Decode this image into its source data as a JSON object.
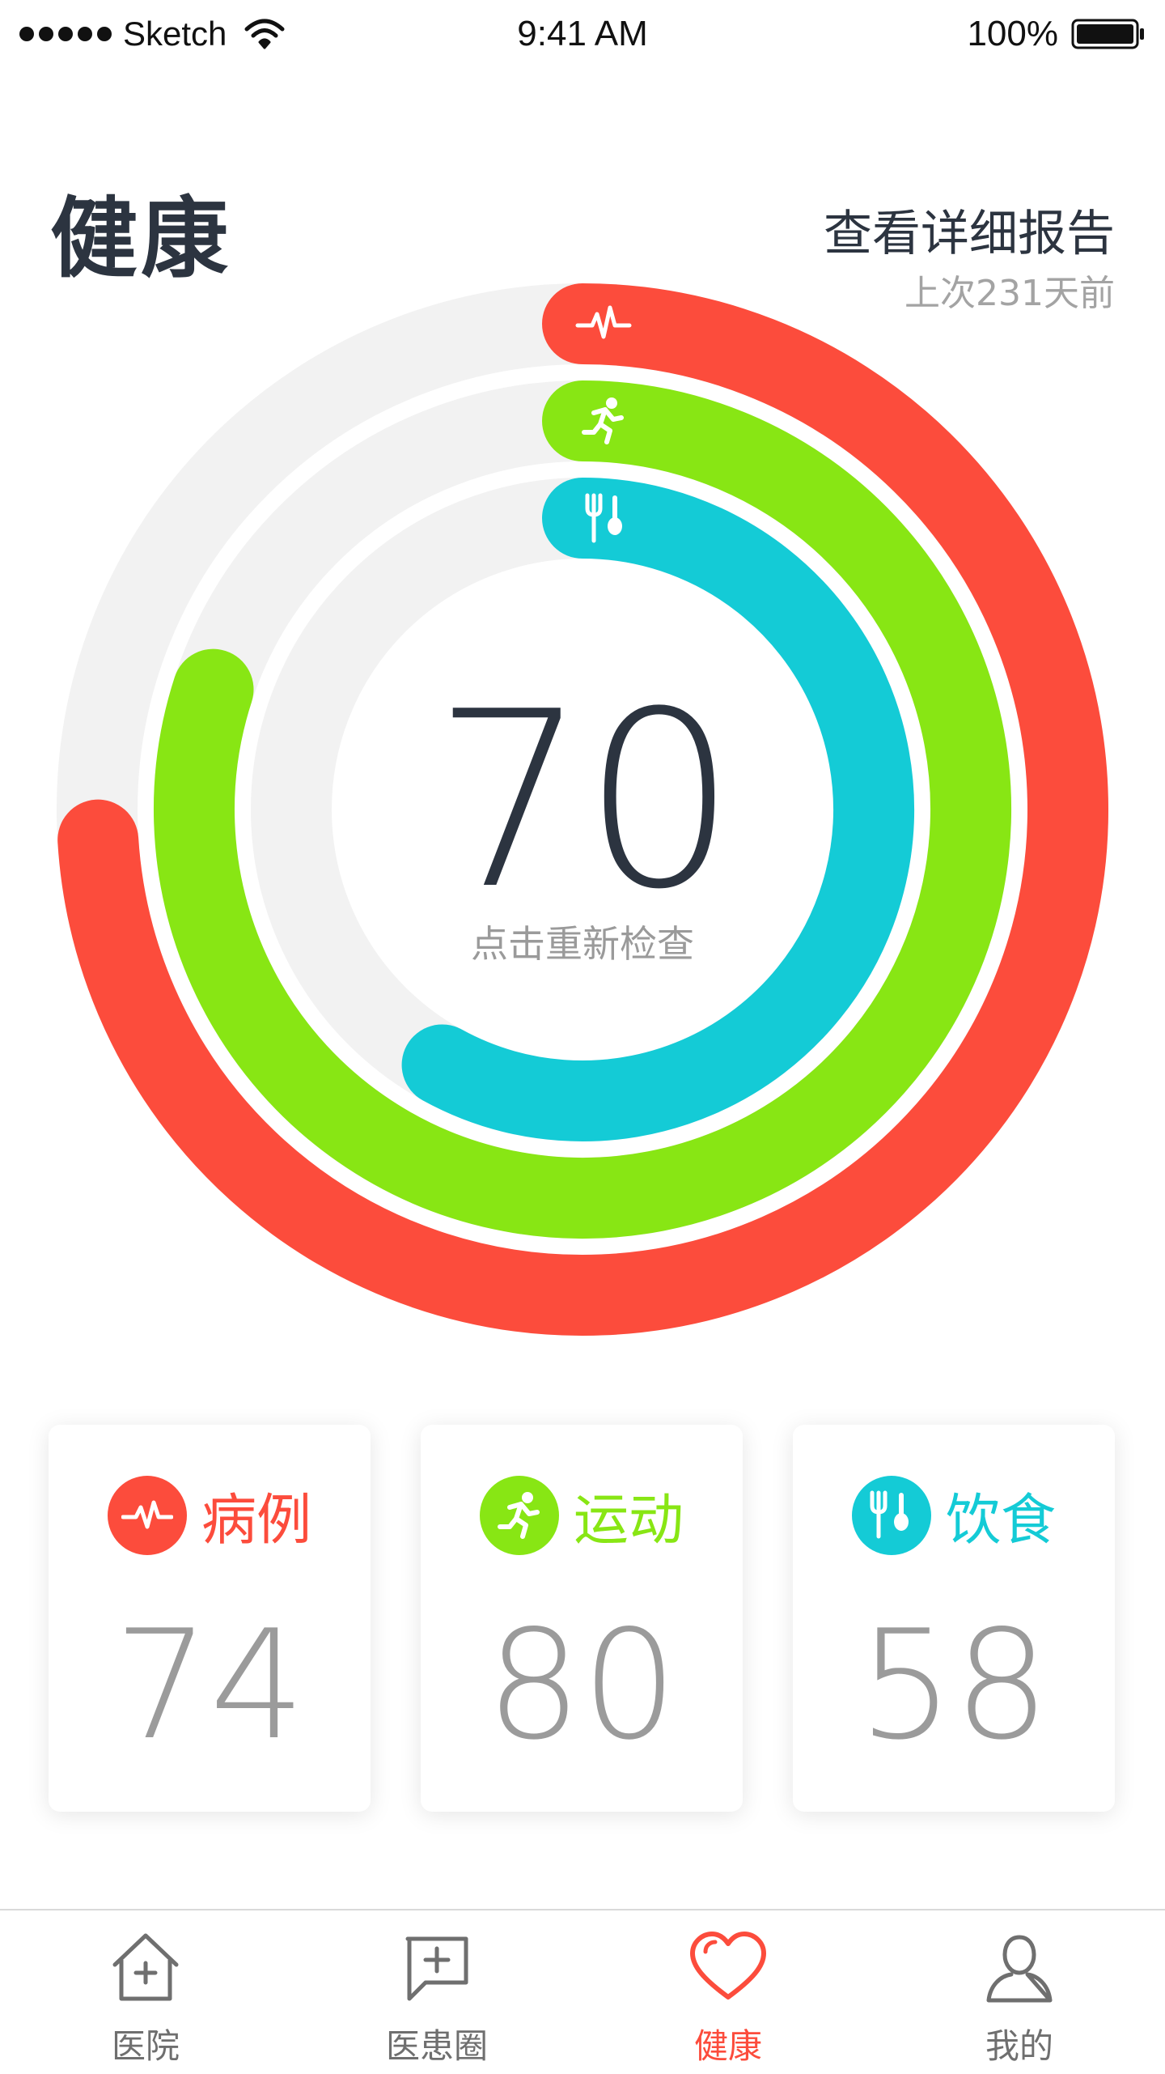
{
  "status_bar": {
    "carrier": "Sketch",
    "time": "9:41 AM",
    "battery": "100%"
  },
  "header": {
    "title": "健康",
    "report_link": "查看详细报告",
    "last_check": "上次231天前"
  },
  "summary": {
    "score": "70",
    "retest_label": "点击重新检查"
  },
  "rings": [
    {
      "name": "病例",
      "value": 74,
      "color": "#fc4c3c",
      "icon": "heartbeat-icon"
    },
    {
      "name": "运动",
      "value": 80,
      "color": "#88e614",
      "icon": "running-icon"
    },
    {
      "name": "饮食",
      "value": 58,
      "color": "#14cbd6",
      "icon": "fork-spoon-icon"
    }
  ],
  "cards": [
    {
      "label": "病例",
      "value": "74",
      "color": "#fc4c3c",
      "icon": "heartbeat-icon"
    },
    {
      "label": "运动",
      "value": "80",
      "color": "#88e614",
      "icon": "running-icon"
    },
    {
      "label": "饮食",
      "value": "58",
      "color": "#14cbd6",
      "icon": "fork-spoon-icon"
    }
  ],
  "tabs": [
    {
      "label": "医院",
      "icon": "hospital-icon",
      "active": false
    },
    {
      "label": "医患圈",
      "icon": "chat-plus-icon",
      "active": false
    },
    {
      "label": "健康",
      "icon": "heart-icon",
      "active": true
    },
    {
      "label": "我的",
      "icon": "user-icon",
      "active": false
    }
  ],
  "colors": {
    "accent": "#fc4c3c",
    "exercise": "#88e614",
    "diet": "#14cbd6",
    "track": "#f2f2f2",
    "text": "#2c3440"
  }
}
